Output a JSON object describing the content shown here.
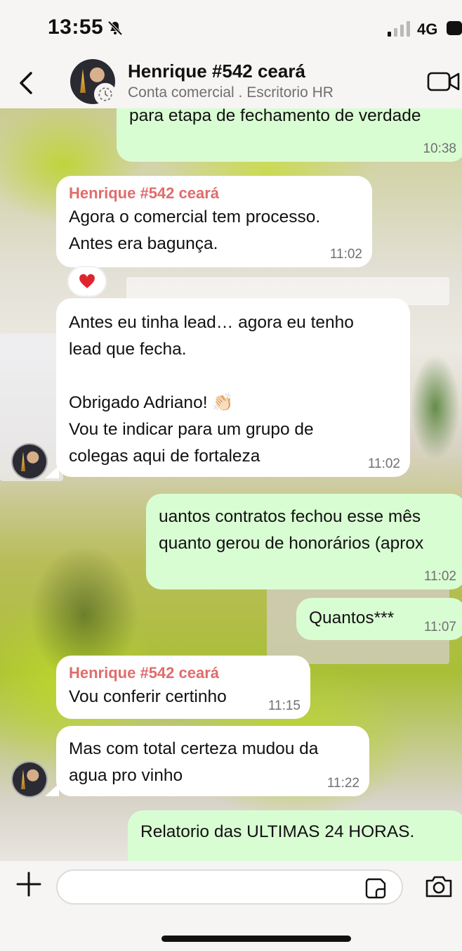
{
  "status_bar": {
    "time": "13:55",
    "network": "4G"
  },
  "header": {
    "contact_name": "Henrique #542 ceará",
    "contact_status": "Conta comercial . Escritorio HR"
  },
  "messages": [
    {
      "direction": "out",
      "text": "para etapa de fechamento de verdade",
      "time": "10:38"
    },
    {
      "direction": "in",
      "sender": "Henrique #542 ceará",
      "text": "Agora o comercial tem processo.\nAntes era bagunça.",
      "time": "11:02",
      "reaction": "❤️"
    },
    {
      "direction": "in",
      "text": "Antes eu tinha lead… agora eu tenho\nlead que fecha.\n\nObrigado Adriano! 👏🏻\nVou te indicar para um grupo de\ncolegas aqui de fortaleza",
      "time": "11:02"
    },
    {
      "direction": "out",
      "text": "uantos contratos fechou esse mês\nquanto gerou de honorários (aprox",
      "time": "11:02"
    },
    {
      "direction": "out",
      "text": "Quantos***",
      "time": "11:07"
    },
    {
      "direction": "in",
      "sender": "Henrique #542 ceará",
      "text": "Vou conferir certinho",
      "time": "11:15"
    },
    {
      "direction": "in",
      "text": "Mas com total certeza mudou da\nagua pro vinho",
      "time": "11:22"
    },
    {
      "direction": "out",
      "text": "Relatorio das ULTIMAS 24 HORAS.",
      "time": ""
    }
  ],
  "input": {
    "value": "",
    "placeholder": ""
  },
  "icons": {
    "back": "chevron-left-icon",
    "video": "video-call-icon",
    "plus": "plus-icon",
    "sticker": "sticker-icon",
    "camera": "camera-icon"
  },
  "colors": {
    "outgoing_bubble": "#d9fdd3",
    "incoming_bubble": "#ffffff",
    "sender_name": "#e06c6c",
    "timestamp": "#707070"
  }
}
